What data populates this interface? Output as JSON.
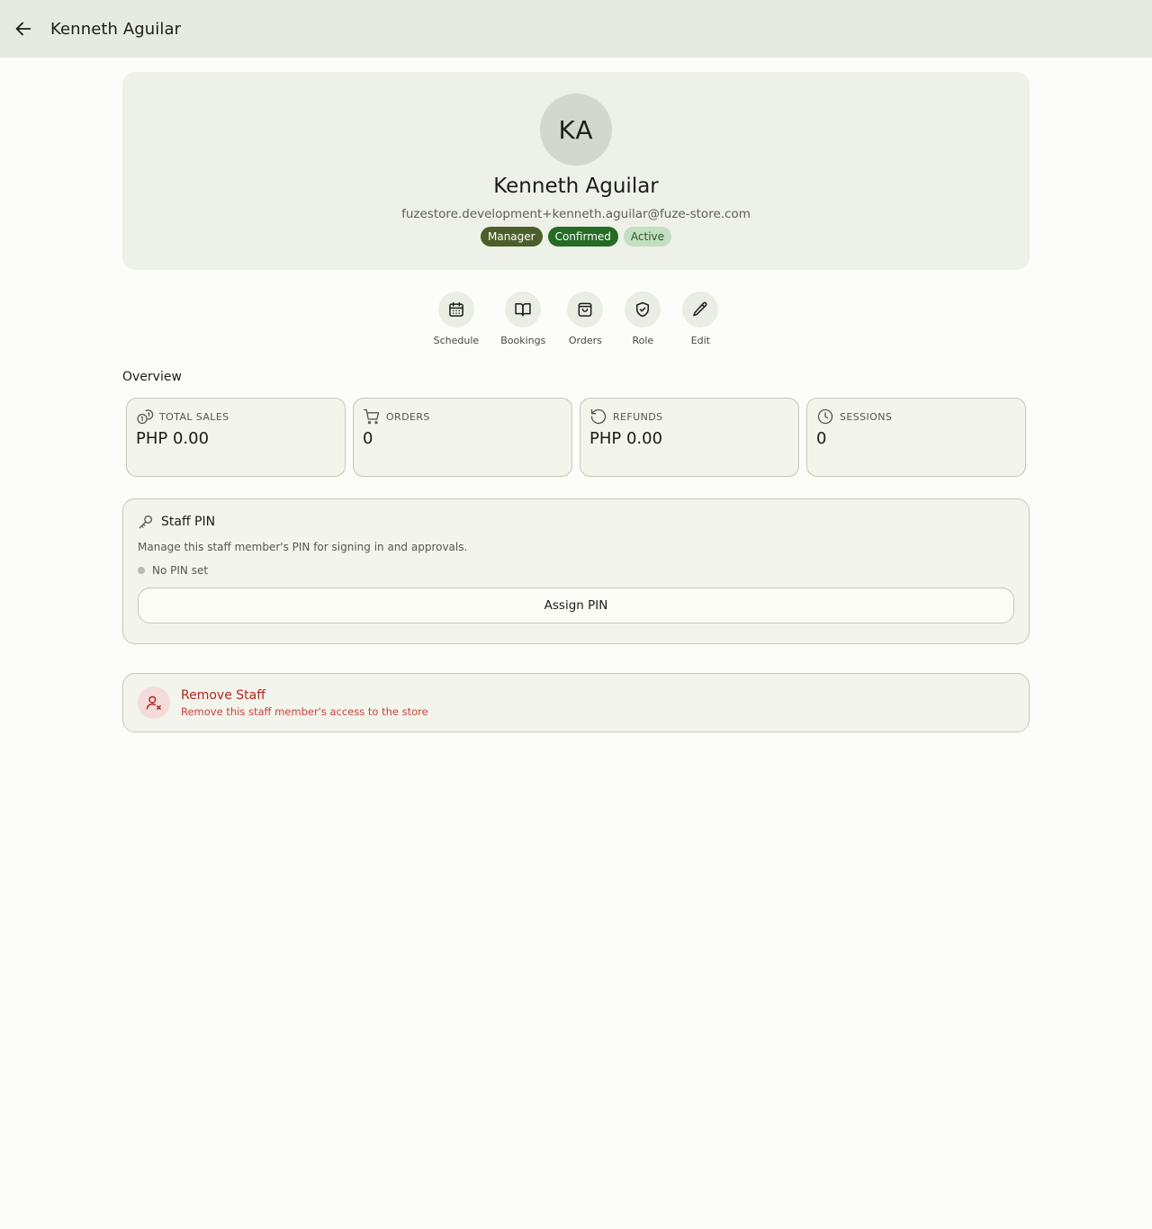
{
  "appbar": {
    "back_icon": "arrow-left-icon",
    "title": "Kenneth Aguilar"
  },
  "profile": {
    "initials": "KA",
    "name": "Kenneth Aguilar",
    "email": "fuzestore.development+kenneth.aguilar@fuze-store.com",
    "badges": {
      "role": "Manager",
      "confirmed": "Confirmed",
      "active": "Active"
    }
  },
  "actions": [
    {
      "label": "Schedule",
      "icon": "calendar-icon"
    },
    {
      "label": "Bookings",
      "icon": "book-open-icon"
    },
    {
      "label": "Orders",
      "icon": "shopping-bag-icon"
    },
    {
      "label": "Role",
      "icon": "shield-check-icon"
    },
    {
      "label": "Edit",
      "icon": "pencil-icon"
    }
  ],
  "overview": {
    "title": "Overview",
    "stats": [
      {
        "label": "TOTAL SALES",
        "value": "PHP 0.00",
        "icon": "coins-icon"
      },
      {
        "label": "ORDERS",
        "value": "0",
        "icon": "cart-icon"
      },
      {
        "label": "REFUNDS",
        "value": "PHP 0.00",
        "icon": "rotate-ccw-icon"
      },
      {
        "label": "SESSIONS",
        "value": "0",
        "icon": "clock-icon"
      }
    ]
  },
  "pin": {
    "icon": "key-icon",
    "title": "Staff PIN",
    "description": "Manage this staff member's PIN for signing in and approvals.",
    "status": "No PIN set",
    "button_label": "Assign PIN"
  },
  "remove": {
    "icon": "user-x-icon",
    "title": "Remove Staff",
    "description": "Remove this staff member's access to the store"
  },
  "colors": {
    "appbar_bg": "#e6ebdf",
    "role_badge": "#4c5f2b",
    "confirmed_badge": "#256b24",
    "active_badge": "#c2dfc0",
    "danger": "#b3261e"
  }
}
